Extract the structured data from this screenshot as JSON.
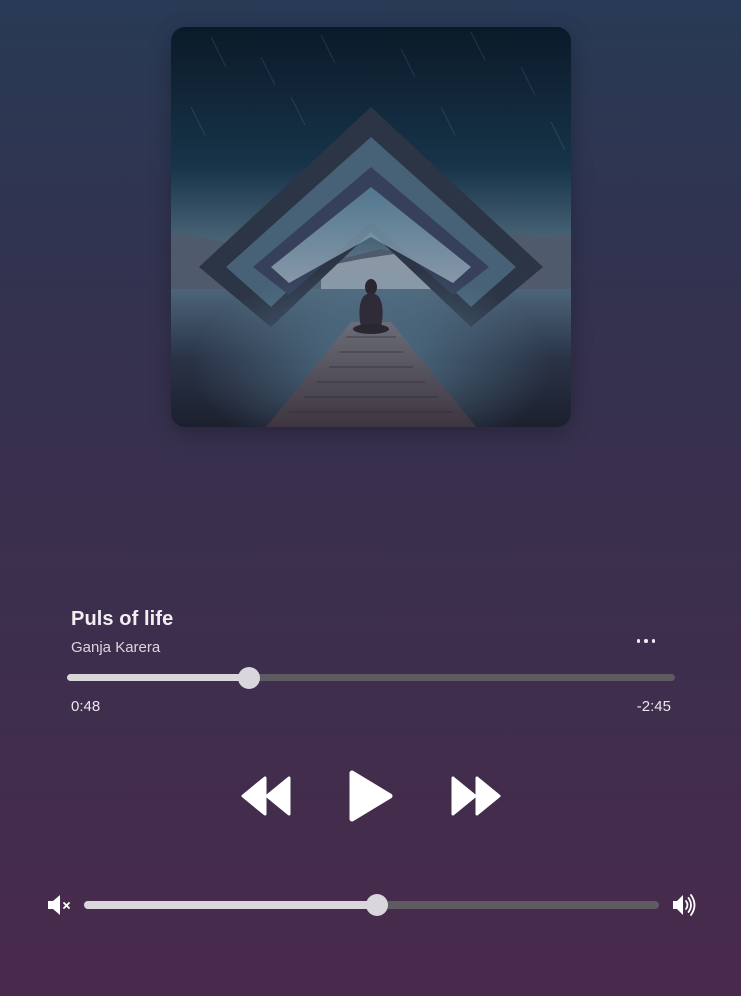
{
  "track": {
    "title": "Puls of life",
    "artist": "Ganja Karera"
  },
  "playback": {
    "elapsed": "0:48",
    "remaining": "-2:45",
    "progress_percent": 29.9,
    "state": "paused"
  },
  "volume": {
    "level_percent": 50.9
  },
  "icons": {
    "more": "more-horizontal-icon",
    "rewind": "rewind-icon",
    "play": "play-icon",
    "forward": "fast-forward-icon",
    "mute": "volume-mute-icon",
    "volume_max": "volume-high-icon"
  },
  "colors": {
    "bg_top": "#283a55",
    "bg_bottom": "#492a4c",
    "slider_fill": "#d9d6dc",
    "slider_track": "#5e5b63",
    "text": "#f1eef4"
  }
}
